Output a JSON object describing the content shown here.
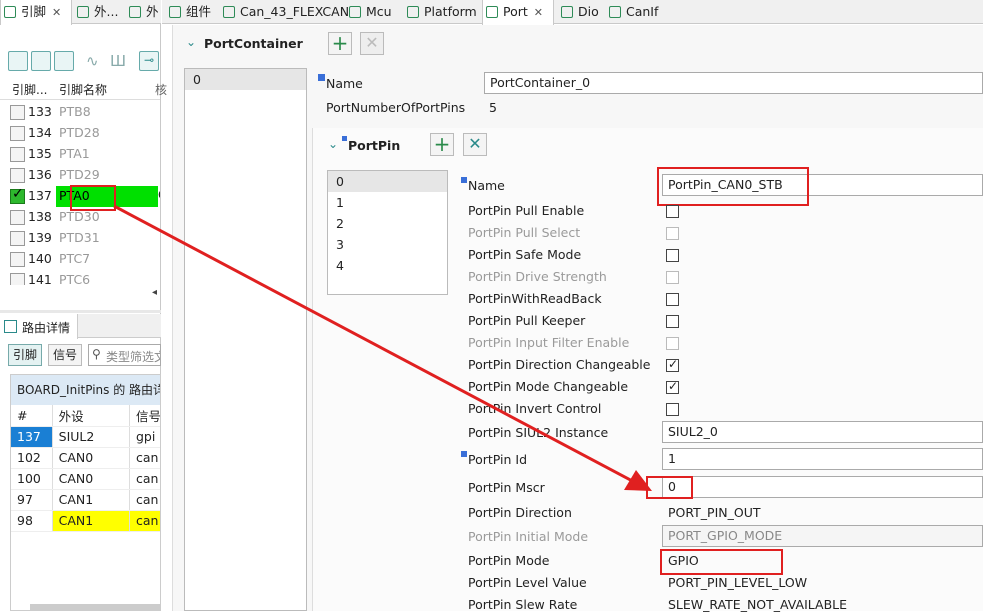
{
  "left_tabs": [
    {
      "label": "引脚",
      "close": "✕"
    },
    {
      "label": "外..."
    },
    {
      "label": "外"
    }
  ],
  "editor_tabs": [
    {
      "label": "组件"
    },
    {
      "label": "Can_43_FLEXCAN"
    },
    {
      "label": "Mcu"
    },
    {
      "label": "Platform"
    },
    {
      "label": "Port",
      "close": "✕"
    },
    {
      "label": "Dio"
    },
    {
      "label": "CanIf"
    }
  ],
  "pins": {
    "header": {
      "num": "引脚...",
      "name": "引脚名称",
      "extra": "核"
    },
    "rows": [
      {
        "num": "133",
        "name": "PTB8",
        "checked": false
      },
      {
        "num": "134",
        "name": "PTD28",
        "checked": false
      },
      {
        "num": "135",
        "name": "PTA1",
        "checked": false
      },
      {
        "num": "136",
        "name": "PTD29",
        "checked": false
      },
      {
        "num": "137",
        "name": "PTA0",
        "checked": true,
        "extra": "C"
      },
      {
        "num": "138",
        "name": "PTD30",
        "checked": false
      },
      {
        "num": "139",
        "name": "PTD31",
        "checked": false
      },
      {
        "num": "140",
        "name": "PTC7",
        "checked": false
      },
      {
        "num": "141",
        "name": "PTC6",
        "checked": false
      }
    ]
  },
  "routing": {
    "tab_label": "路由详情",
    "btn_pins": "引脚",
    "btn_signals": "信号",
    "filter_placeholder": "类型筛选文",
    "group_title": "BOARD_InitPins 的 路由详",
    "columns": [
      "#",
      "外设",
      "信号"
    ],
    "rows": [
      {
        "num": "137",
        "periph": "SIUL2",
        "sig": "gpi"
      },
      {
        "num": "102",
        "periph": "CAN0",
        "sig": "can"
      },
      {
        "num": "100",
        "periph": "CAN0",
        "sig": "can"
      },
      {
        "num": "97",
        "periph": "CAN1",
        "sig": "can"
      },
      {
        "num": "98",
        "periph": "CAN1",
        "sig": "can"
      }
    ]
  },
  "port_container": {
    "title": "PortContainer",
    "list": [
      "0"
    ],
    "name_label": "Name",
    "name_value": "PortContainer_0",
    "num_pins_label": "PortNumberOfPortPins",
    "num_pins_value": "5"
  },
  "port_pin": {
    "title": "PortPin",
    "list": [
      "0",
      "1",
      "2",
      "3",
      "4"
    ],
    "name_label": "Name",
    "name_value": "PortPin_CAN0_STB",
    "props": [
      {
        "label": "PortPin Pull Enable",
        "type": "check",
        "checked": false,
        "disabled": false
      },
      {
        "label": "PortPin Pull Select",
        "type": "check",
        "checked": false,
        "disabled": true
      },
      {
        "label": "PortPin Safe Mode",
        "type": "check",
        "checked": false,
        "disabled": false
      },
      {
        "label": "PortPin Drive Strength",
        "type": "check",
        "checked": false,
        "disabled": true
      },
      {
        "label": "PortPinWithReadBack",
        "type": "check",
        "checked": false,
        "disabled": false
      },
      {
        "label": "PortPin Pull Keeper",
        "type": "check",
        "checked": false,
        "disabled": false
      },
      {
        "label": "PortPin Input Filter Enable",
        "type": "check",
        "checked": false,
        "disabled": true
      },
      {
        "label": "PortPin Direction Changeable",
        "type": "check",
        "checked": true,
        "disabled": false
      },
      {
        "label": "PortPin Mode Changeable",
        "type": "check",
        "checked": true,
        "disabled": false
      },
      {
        "label": "PortPin Invert Control",
        "type": "check",
        "checked": false,
        "disabled": false
      }
    ],
    "siul2_label": "PortPin SIUL2 Instance",
    "siul2_value": "SIUL2_0",
    "id_label": "PortPin Id",
    "id_value": "1",
    "mscr_label": "PortPin Mscr",
    "mscr_value": "0",
    "direction_label": "PortPin Direction",
    "direction_value": "PORT_PIN_OUT",
    "initial_mode_label": "PortPin Initial Mode",
    "initial_mode_value": "PORT_GPIO_MODE",
    "mode_label": "PortPin Mode",
    "mode_value": "GPIO",
    "level_label": "PortPin Level Value",
    "level_value": "PORT_PIN_LEVEL_LOW",
    "slew_label": "PortPin Slew Rate",
    "slew_value": "SLEW_RATE_NOT_AVAILABLE"
  },
  "colors": {
    "highlight_green": "#00e000",
    "highlight_yellow": "#ffff00",
    "selected_blue": "#1a7fd4",
    "annotation_red": "#e02020"
  }
}
